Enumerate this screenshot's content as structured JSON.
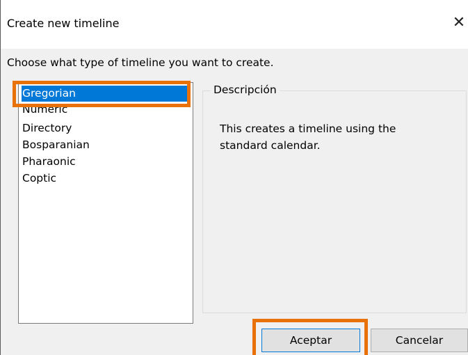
{
  "window": {
    "title": "Create new timeline",
    "close_glyph": "✕"
  },
  "prompt": "Choose what type of timeline you want to create.",
  "timeline_types": {
    "items": [
      "Gregorian",
      "Numeric",
      "Directory",
      "Bosparanian",
      "Pharaonic",
      "Coptic"
    ],
    "selected": "Gregorian"
  },
  "description": {
    "legend": "Descripción",
    "text": "This creates a timeline using the standard calendar."
  },
  "buttons": {
    "ok": "Aceptar",
    "cancel": "Cancelar"
  },
  "colors": {
    "selection": "#0078d7",
    "highlight_outline": "#e8710a"
  }
}
